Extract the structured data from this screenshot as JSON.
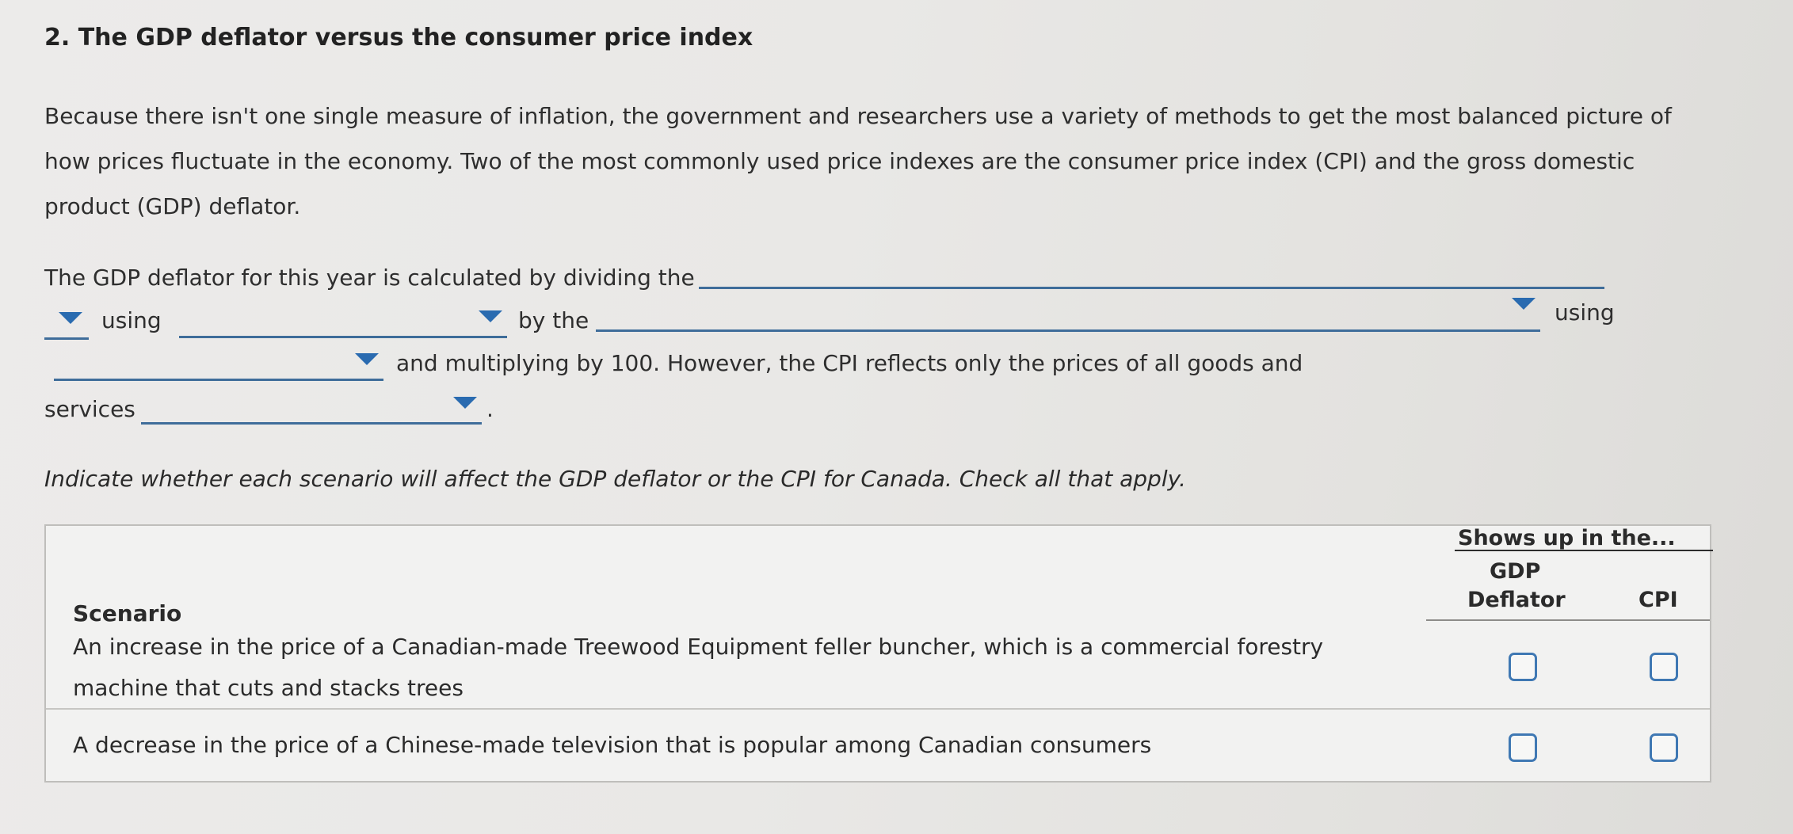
{
  "question": {
    "title": "2. The GDP deflator versus the consumer price index",
    "intro": "Because there isn't one single measure of inflation, the government and researchers use a variety of methods to get the most balanced picture of how prices fluctuate in the economy. Two of the most commonly used price indexes are the consumer price index (CPI) and the gross domestic product (GDP) deflator."
  },
  "sentence": {
    "part1": "The GDP deflator for this year is calculated by dividing the",
    "part2": "using",
    "part3": "by the",
    "part4": "using",
    "part5": "and multiplying by 100. However, the CPI reflects only the prices of all goods and",
    "part6": "services",
    "part7": "."
  },
  "dropdowns": [
    {
      "value": ""
    },
    {
      "value": ""
    },
    {
      "value": ""
    },
    {
      "value": ""
    },
    {
      "value": ""
    }
  ],
  "instruction": "Indicate whether each scenario will affect the GDP deflator or the CPI for Canada. Check all that apply.",
  "table": {
    "group_header": "Shows up in the...",
    "col_scenario": "Scenario",
    "col_gdp_line1": "GDP",
    "col_gdp_line2": "Deflator",
    "col_cpi": "CPI",
    "rows": [
      {
        "line1": "An increase in the price of a Canadian-made Treewood Equipment feller buncher, which is a commercial forestry",
        "line2": "machine that cuts and stacks trees",
        "gdp_checked": false,
        "cpi_checked": false
      },
      {
        "line1": "A decrease in the price of a Chinese-made television that is popular among Canadian consumers",
        "line2": "",
        "gdp_checked": false,
        "cpi_checked": false
      }
    ]
  },
  "colors": {
    "accent": "#2a6bb0",
    "checkbox_border": "#3f78b3"
  }
}
